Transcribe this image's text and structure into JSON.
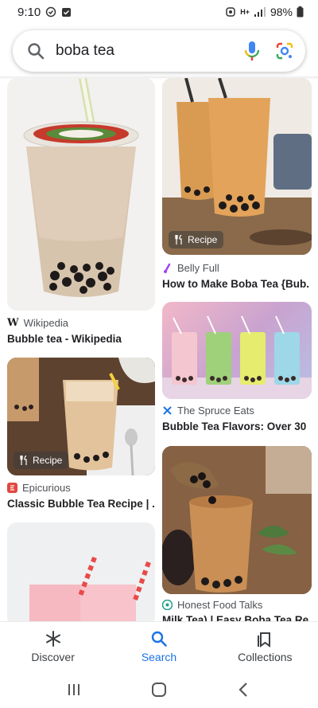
{
  "status_bar": {
    "time": "9:10",
    "battery": "98%",
    "network": "H+"
  },
  "search": {
    "query": "boba tea"
  },
  "results": [
    {
      "source": "Wikipedia",
      "title": "Bubble tea - Wikipedia",
      "badge": "",
      "icon": "wikipedia-icon"
    },
    {
      "source": "Belly Full",
      "title": "How to Make Boba Tea {Bub...",
      "badge": "Recipe",
      "icon": "bellyfull-icon"
    },
    {
      "source": "The Spruce Eats",
      "title": "Bubble Tea Flavors: Over 30 ...",
      "badge": "",
      "icon": "spruce-icon"
    },
    {
      "source": "Epicurious",
      "title": "Classic Bubble Tea Recipe | ...",
      "badge": "Recipe",
      "icon": "epicurious-icon"
    },
    {
      "source": "Honest Food Talks",
      "title": "Milk Tea) | Easy Boba Tea Re...",
      "badge": "",
      "icon": "honest-icon"
    }
  ],
  "bottom_nav": {
    "discover": "Discover",
    "search": "Search",
    "collections": "Collections"
  },
  "colors": {
    "accent": "#1a73e8"
  }
}
